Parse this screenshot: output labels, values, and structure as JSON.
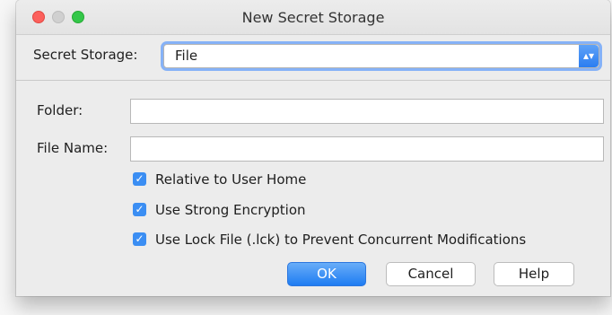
{
  "window": {
    "title": "New Secret Storage"
  },
  "storage": {
    "label": "Secret Storage:",
    "selected": "File",
    "arrow_icon": "up-down-chevron-icon"
  },
  "folder": {
    "label": "Folder:",
    "value": ""
  },
  "file_name": {
    "label": "File Name:",
    "value": ""
  },
  "options": [
    {
      "label": "Relative to User Home",
      "checked": true
    },
    {
      "label": "Use Strong Encryption",
      "checked": true
    },
    {
      "label": "Use Lock File (.lck) to Prevent Concurrent Modifications",
      "checked": true
    }
  ],
  "buttons": {
    "ok": "OK",
    "cancel": "Cancel",
    "help": "Help"
  },
  "colors": {
    "accent": "#2a7df1",
    "checkbox": "#3b8ef3",
    "close": "#fc605c",
    "max": "#34c749"
  }
}
